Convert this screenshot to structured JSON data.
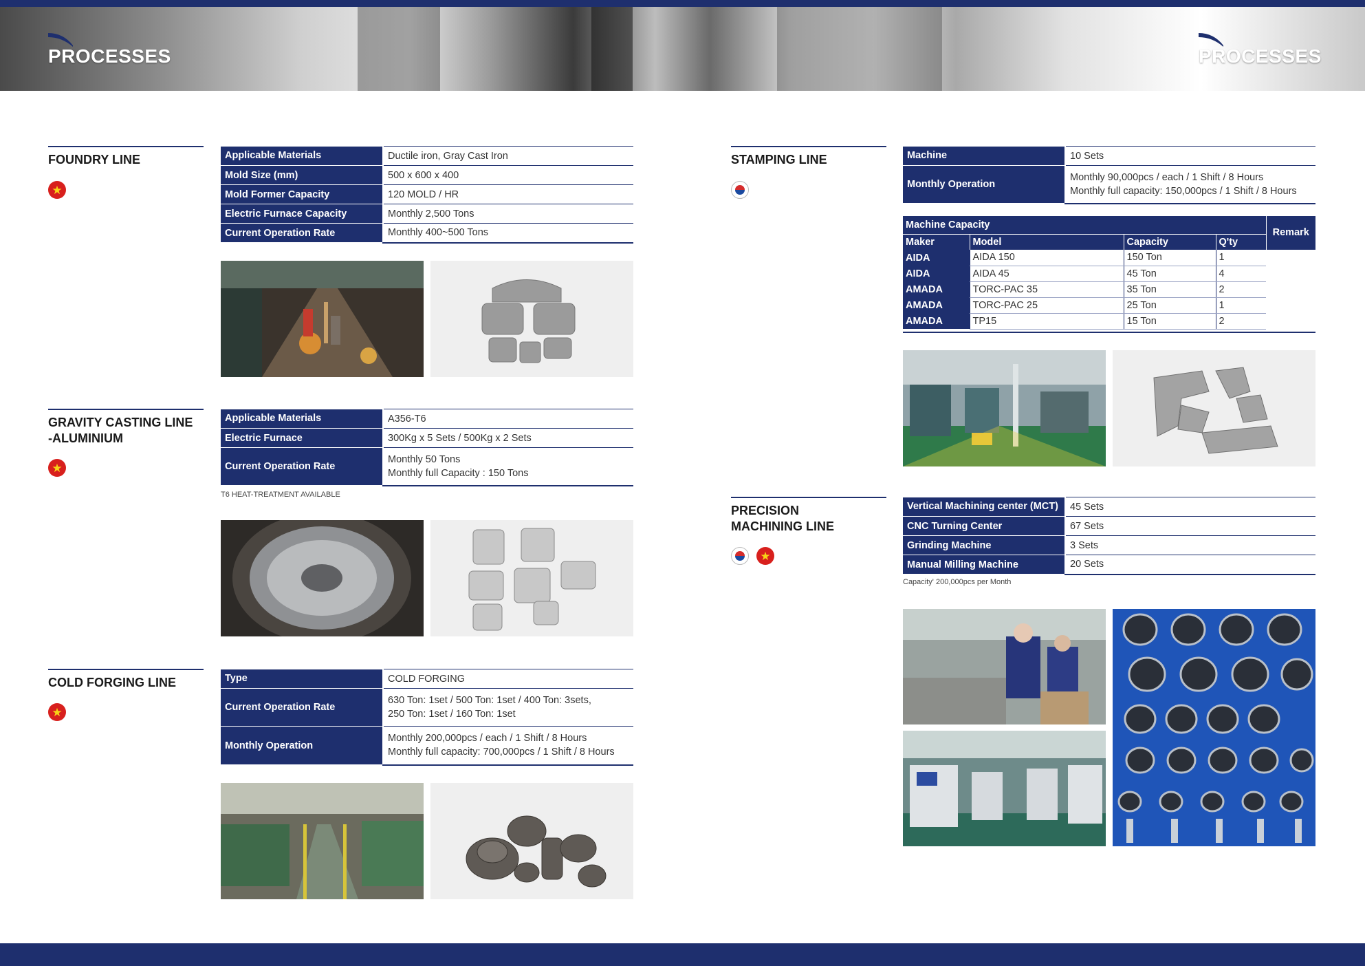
{
  "header": {
    "left_title": "PROCESSES",
    "right_title": "PROCESSES"
  },
  "foundry": {
    "title": "FOUNDRY LINE",
    "flags": [
      "vietnam-flag"
    ],
    "rows": [
      {
        "k": "Applicable Materials",
        "v": "Ductile iron, Gray Cast Iron"
      },
      {
        "k": "Mold Size (mm)",
        "v": "500 x 600 x 400"
      },
      {
        "k": "Mold Former Capacity",
        "v": "120 MOLD / HR"
      },
      {
        "k": "Electric Furnace Capacity",
        "v": "Monthly 2,500 Tons"
      },
      {
        "k": "Current Operation Rate",
        "v": "Monthly 400~500 Tons"
      }
    ]
  },
  "gravity": {
    "title_line1": "GRAVITY CASTING LINE",
    "title_line2": "-ALUMINIUM",
    "flags": [
      "vietnam-flag"
    ],
    "rows": [
      {
        "k": "Applicable Materials",
        "v": "A356-T6"
      },
      {
        "k": "Electric Furnace",
        "v": "300Kg x 5 Sets / 500Kg x 2 Sets"
      },
      {
        "k": "Current Operation Rate",
        "v1": "Monthly 50 Tons",
        "v2": "Monthly full Capacity : 150 Tons"
      }
    ],
    "note": "T6 HEAT-TREATMENT AVAILABLE"
  },
  "cold": {
    "title": "COLD FORGING LINE",
    "flags": [
      "vietnam-flag"
    ],
    "rows": [
      {
        "k": "Type",
        "v": "COLD FORGING"
      },
      {
        "k": "Current Operation Rate",
        "v1": "630 Ton: 1set / 500 Ton: 1set / 400 Ton: 3sets,",
        "v2": "250 Ton: 1set / 160 Ton: 1set"
      },
      {
        "k": "Monthly Operation",
        "v1": "Monthly 200,000pcs / each / 1 Shift / 8 Hours",
        "v2": "Monthly full capacity: 700,000pcs / 1 Shift / 8 Hours"
      }
    ]
  },
  "stamping": {
    "title": "STAMPING LINE",
    "flags": [
      "korea-flag"
    ],
    "rows": [
      {
        "k": "Machine",
        "v": "10 Sets"
      },
      {
        "k": "Monthly Operation",
        "v1": "Monthly 90,000pcs / each / 1 Shift / 8 Hours",
        "v2": "Monthly full capacity: 150,000pcs / 1 Shift / 8 Hours"
      }
    ],
    "capacity": {
      "caption": "Machine Capacity",
      "remark": "Remark",
      "headers": [
        "Maker",
        "Model",
        "Capacity",
        "Q'ty"
      ],
      "rows": [
        [
          "AIDA",
          "AIDA 150",
          "150 Ton",
          "1"
        ],
        [
          "AIDA",
          "AIDA 45",
          "45 Ton",
          "4"
        ],
        [
          "AMADA",
          "TORC-PAC 35",
          "35 Ton",
          "2"
        ],
        [
          "AMADA",
          "TORC-PAC 25",
          "25 Ton",
          "1"
        ],
        [
          "AMADA",
          "TP15",
          "15 Ton",
          "2"
        ]
      ]
    }
  },
  "precision": {
    "title_line1": "PRECISION",
    "title_line2": "MACHINING LINE",
    "flags": [
      "korea-flag",
      "vietnam-flag"
    ],
    "rows": [
      {
        "k": "Vertical Machining center (MCT)",
        "v": "45 Sets"
      },
      {
        "k": "CNC Turning Center",
        "v": "67 Sets"
      },
      {
        "k": "Grinding Machine",
        "v": "3 Sets"
      },
      {
        "k": "Manual Milling Machine",
        "v": "20 Sets"
      }
    ],
    "note": "Capacity' 200,000pcs per Month"
  },
  "colors": {
    "navy": "#1e2f6e",
    "vn_red": "#d8201d",
    "vn_star": "#f7d417"
  }
}
